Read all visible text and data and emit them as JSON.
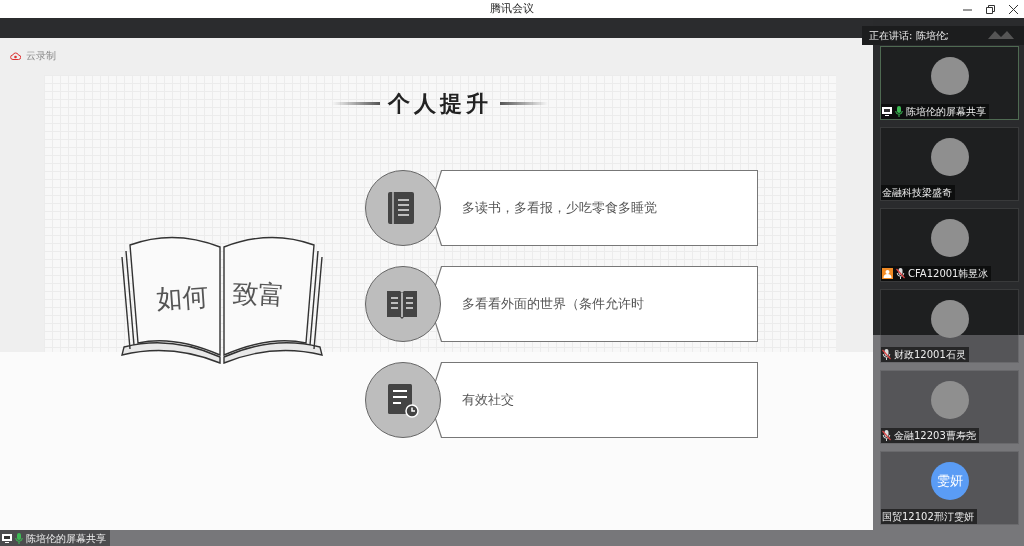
{
  "window": {
    "title": "腾讯会议"
  },
  "recording": {
    "label": "云录制"
  },
  "slide": {
    "title": "个人提升",
    "book_text": [
      "如何",
      "致富"
    ],
    "items": [
      {
        "kind": "book",
        "text": "多读书，多看报，少吃零食多睡觉"
      },
      {
        "kind": "open-book",
        "text": "多看看外面的世界（条件允许时"
      },
      {
        "kind": "document-clock",
        "text": "有效社交"
      }
    ]
  },
  "speaking": {
    "label": "正在讲话: 陈培伦;"
  },
  "participants": [
    {
      "name": "陈培伦的屏幕共享",
      "screen_sharing": true,
      "mic_on": true,
      "mic_muted": false,
      "host": false,
      "selected": true
    },
    {
      "name": "金融科技梁盛奇",
      "screen_sharing": false,
      "mic_on": false,
      "mic_muted": false,
      "host": false,
      "selected": false
    },
    {
      "name": "CFA12001韩昱冰",
      "screen_sharing": false,
      "mic_on": false,
      "mic_muted": true,
      "host": true,
      "selected": false
    },
    {
      "name": "财政12001石灵",
      "screen_sharing": false,
      "mic_on": false,
      "mic_muted": true,
      "host": false,
      "selected": false
    },
    {
      "name": "金融12203曹寿尧",
      "screen_sharing": false,
      "mic_on": false,
      "mic_muted": true,
      "host": false,
      "selected": false
    },
    {
      "name": "国贸12102邢汀雯妍",
      "initials": "雯妍",
      "screen_sharing": false,
      "mic_on": false,
      "mic_muted": false,
      "host": false,
      "selected": false
    }
  ],
  "share_bar": {
    "label": "陈培伦的屏幕共享",
    "screen_sharing": true,
    "mic_on": true
  }
}
